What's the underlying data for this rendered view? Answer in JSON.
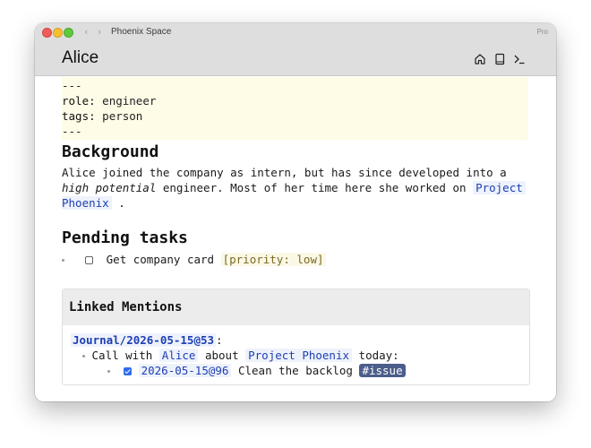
{
  "window": {
    "title": "Phoenix Space",
    "badge": "Pro",
    "back_glyph": "‹",
    "forward_glyph": "›"
  },
  "header": {
    "page_name": "Alice",
    "icons": [
      "home-icon",
      "book-icon",
      "terminal-icon"
    ]
  },
  "frontmatter": {
    "delim_open": "---",
    "role_key": "role:",
    "role_value": "engineer",
    "tags_key": "tags:",
    "tags_value": "person",
    "delim_close": "---"
  },
  "background": {
    "heading": "Background",
    "line1": "Alice joined the company as intern, but has since developed into a",
    "emph": "high potential",
    "mid": " engineer. Most of her time here she worked on ",
    "link_part1": "Project",
    "link_part2": "Phoenix",
    "end": "."
  },
  "tasks": {
    "heading": "Pending tasks",
    "items": [
      {
        "text": "Get company card",
        "attr_open": "[",
        "attr_key": "priority:",
        "attr_value": "low",
        "attr_close": "]"
      }
    ]
  },
  "linked_mentions": {
    "title": "Linked Mentions",
    "source": "Journal/2026-05-15@53",
    "source_suffix": ":",
    "line": {
      "pre": "Call with ",
      "link1": "Alice",
      "mid": " about ",
      "link2": "Project Phoenix",
      "post": " today:"
    },
    "subtask": {
      "date_link": "2026-05-15@96",
      "text": "Clean the backlog",
      "tag": "#issue"
    }
  }
}
